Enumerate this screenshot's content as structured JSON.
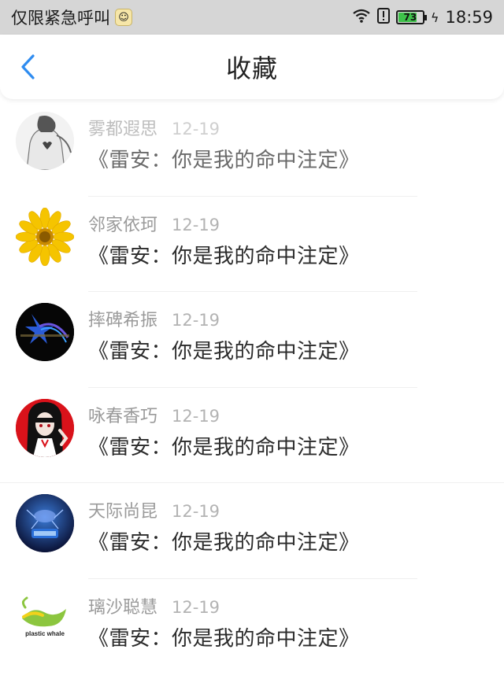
{
  "status": {
    "carrier_text": "仅限紧急呼叫",
    "battery_level": "73",
    "time": "18:59",
    "icons": [
      "sim-icon",
      "wifi-icon",
      "alert-icon",
      "battery-icon",
      "charging-icon"
    ]
  },
  "nav": {
    "title": "收藏",
    "back_icon": "chevron-left-icon"
  },
  "colors": {
    "accent": "#2f8cf0",
    "status_bar_bg": "#d6d6d6",
    "battery_green": "#3ec24a"
  },
  "items": [
    {
      "name": "雾都遐思",
      "date": "12-19",
      "title": "《雷安：你是我的命中注定》",
      "avatar": "avatar-sketch-figure"
    },
    {
      "name": "邻家依珂",
      "date": "12-19",
      "title": "《雷安：你是我的命中注定》",
      "avatar": "avatar-sunflower"
    },
    {
      "name": "摔碑希振",
      "date": "12-19",
      "title": "《雷安：你是我的命中注定》",
      "avatar": "avatar-dark-star"
    },
    {
      "name": "咏春香巧",
      "date": "12-19",
      "title": "《雷安：你是我的命中注定》",
      "avatar": "avatar-anime-girl"
    },
    {
      "name": "天际尚昆",
      "date": "12-19",
      "title": "《雷安：你是我的命中注定》",
      "avatar": "avatar-blue-logo"
    },
    {
      "name": "璃沙聪慧",
      "date": "12-19",
      "title": "《雷安：你是我的命中注定》",
      "avatar": "avatar-plastic-whale",
      "avatar_text": "plastic whale"
    }
  ]
}
